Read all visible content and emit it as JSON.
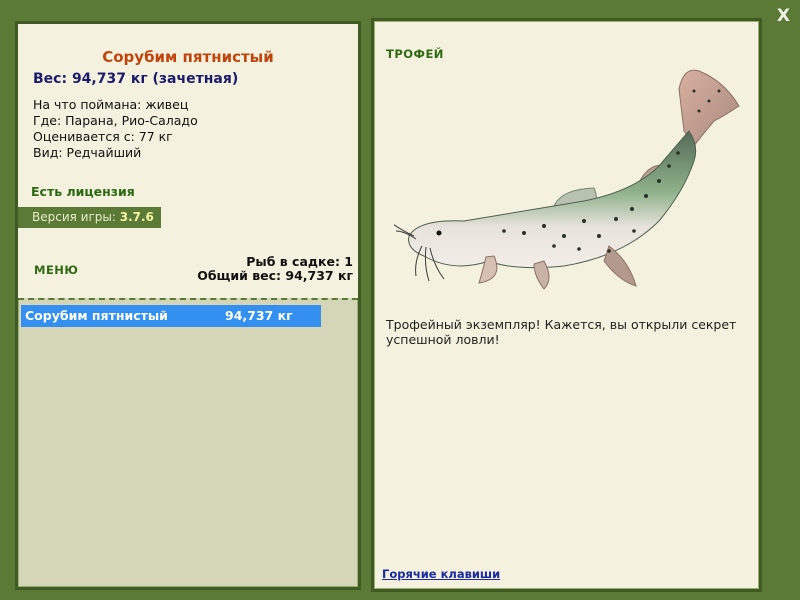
{
  "close_label": "X",
  "fish": {
    "name": "Сорубим пятнистый",
    "weight_line": "Вес: 94,737 кг (зачетная)",
    "bait_line": "На что поймана: живец",
    "location_line": "Где: Парана, Рио-Саладо",
    "rated_line": "Оценивается с: 77 кг",
    "rarity_line": "Вид: Редчайший"
  },
  "license": "Есть лицензия",
  "version": {
    "label": "Версия игры: ",
    "value": "3.7.6"
  },
  "menu_label": "МЕНЮ",
  "keepnet": {
    "count_line": "Рыб в садке: 1",
    "total_line": "Общий вес: 94,737 кг"
  },
  "catch_list": [
    {
      "name": "Сорубим пятнистый",
      "weight": "94,737 кг"
    }
  ],
  "trophy": {
    "label": "ТРОФЕЙ",
    "image": "catfish-image",
    "description": "Трофейный экземпляр! Кажется, вы открыли секрет успешной ловли!"
  },
  "hotkeys_link": "Горячие клавиши",
  "colors": {
    "frame": "#5b7a35",
    "panel_light": "#f4f2de",
    "panel_muted": "#d5d6b8",
    "title": "#c0450d",
    "weight": "#1c1c6e",
    "accent_green": "#2f6a12",
    "selection": "#3390f0",
    "link": "#1a2aa0"
  }
}
